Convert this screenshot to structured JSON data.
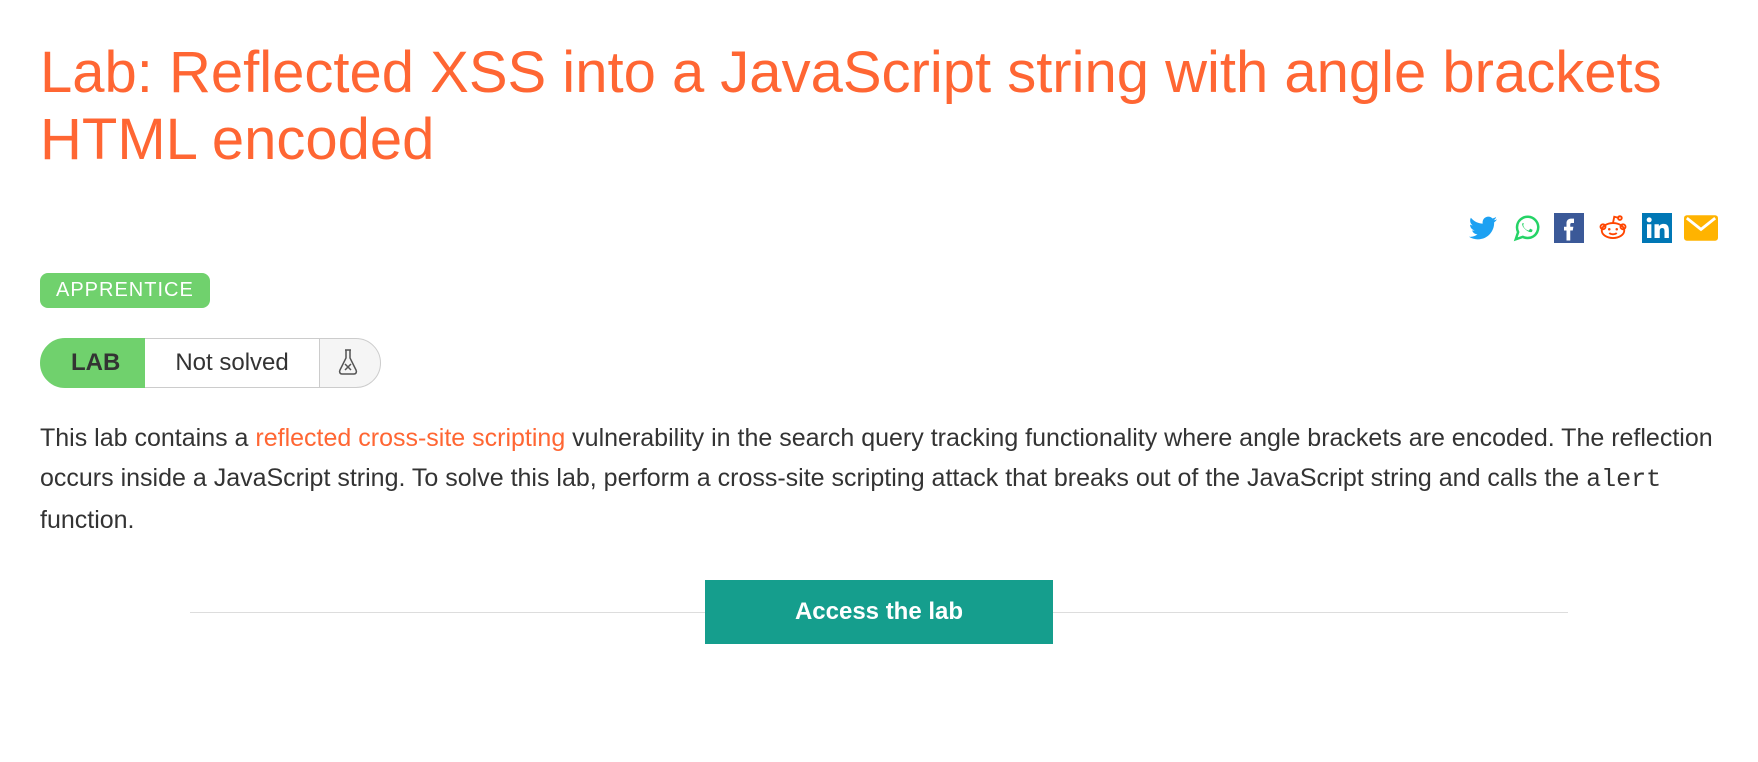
{
  "title": "Lab: Reflected XSS into a JavaScript string with angle brackets HTML encoded",
  "difficulty": "APPRENTICE",
  "status": {
    "lab_label": "LAB",
    "solved_text": "Not solved"
  },
  "description": {
    "part1": "This lab contains a ",
    "link_text": "reflected cross-site scripting",
    "part2": " vulnerability in the search query tracking functionality where angle brackets are encoded. The reflection occurs inside a JavaScript string. To solve this lab, perform a cross-site scripting attack that breaks out of the JavaScript string and calls the ",
    "code": "alert",
    "part3": " function."
  },
  "cta": "Access the lab",
  "share_icons": {
    "twitter": "twitter",
    "whatsapp": "whatsapp",
    "facebook": "facebook",
    "reddit": "reddit",
    "linkedin": "linkedin",
    "email": "email"
  }
}
